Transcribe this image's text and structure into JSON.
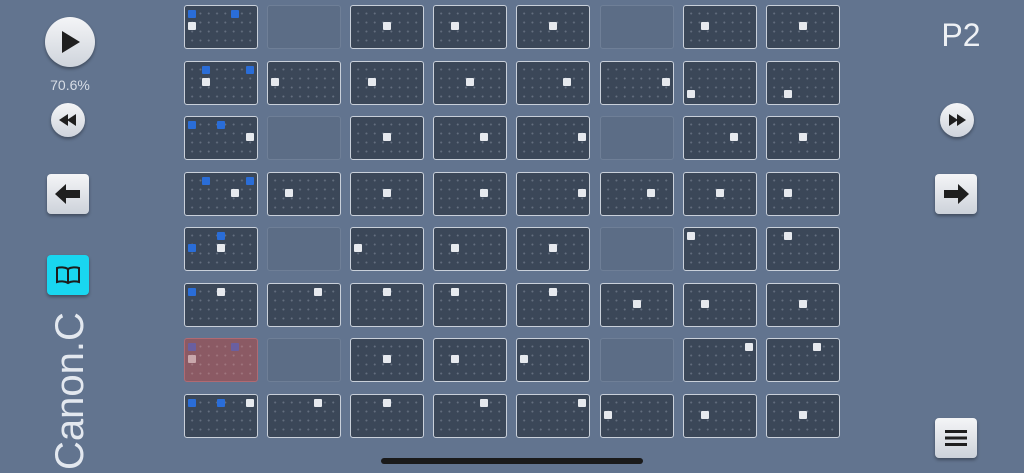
{
  "app": {
    "tempo_label": "70.6%",
    "pattern_label": "P2",
    "song_name": "Canon.C"
  },
  "colors": {
    "background": "#62748f",
    "cell_active": "#3b4758",
    "cell_empty": "#5c6d86",
    "cell_alert": "#8b5a64",
    "note_white": "#e6e9ee",
    "note_blue": "#2a6dd8",
    "book_button": "#19d6f0"
  },
  "icons": {
    "play": "play-icon",
    "rewind": "rewind-icon",
    "fast_forward": "fast-forward-icon",
    "prev": "arrow-left-icon",
    "next": "arrow-right-icon",
    "book": "book-icon",
    "menu": "menu-icon"
  },
  "grid": {
    "rows": [
      [
        "A",
        "E",
        "A",
        "A",
        "A",
        "E",
        "A",
        "A"
      ],
      [
        "A",
        "A",
        "A",
        "A",
        "A",
        "A",
        "A",
        "A"
      ],
      [
        "A",
        "E",
        "A",
        "A",
        "A",
        "E",
        "A",
        "A"
      ],
      [
        "A",
        "A",
        "A",
        "A",
        "A",
        "A",
        "A",
        "A"
      ],
      [
        "A",
        "E",
        "A",
        "A",
        "A",
        "E",
        "A",
        "A"
      ],
      [
        "A",
        "A",
        "A",
        "A",
        "A",
        "A",
        "A",
        "A"
      ],
      [
        "R",
        "E",
        "A",
        "A",
        "A",
        "E",
        "A",
        "A"
      ],
      [
        "A",
        "A",
        "A",
        "A",
        "A",
        "A",
        "A",
        "A"
      ]
    ],
    "notes": [
      [
        [
          [
            "b",
            0,
            0
          ],
          [
            "b",
            6,
            0
          ],
          [
            "w",
            0,
            2
          ]
        ],
        [],
        [
          [
            "w",
            4,
            2
          ]
        ],
        [
          [
            "w",
            2,
            2
          ]
        ],
        [
          [
            "w",
            4,
            2
          ]
        ],
        [],
        [
          [
            "w",
            2,
            2
          ]
        ],
        [
          [
            "w",
            4,
            2
          ]
        ]
      ],
      [
        [
          [
            "b",
            2,
            0
          ],
          [
            "b",
            8,
            0
          ],
          [
            "w",
            2,
            2
          ]
        ],
        [
          [
            "w",
            0,
            2
          ]
        ],
        [
          [
            "w",
            2,
            2
          ]
        ],
        [
          [
            "w",
            4,
            2
          ]
        ],
        [
          [
            "w",
            6,
            2
          ]
        ],
        [
          [
            "w",
            8,
            2
          ]
        ],
        [
          [
            "w",
            0,
            4
          ]
        ],
        [
          [
            "w",
            2,
            4
          ]
        ]
      ],
      [
        [
          [
            "b",
            0,
            0
          ],
          [
            "b",
            4,
            0
          ],
          [
            "w",
            8,
            2
          ]
        ],
        [],
        [
          [
            "w",
            4,
            2
          ]
        ],
        [
          [
            "w",
            6,
            2
          ]
        ],
        [
          [
            "w",
            8,
            2
          ]
        ],
        [],
        [
          [
            "w",
            6,
            2
          ]
        ],
        [
          [
            "w",
            4,
            2
          ]
        ]
      ],
      [
        [
          [
            "b",
            2,
            0
          ],
          [
            "b",
            8,
            0
          ],
          [
            "w",
            6,
            2
          ]
        ],
        [
          [
            "w",
            2,
            2
          ]
        ],
        [
          [
            "w",
            4,
            2
          ]
        ],
        [
          [
            "w",
            6,
            2
          ]
        ],
        [
          [
            "w",
            8,
            2
          ]
        ],
        [
          [
            "w",
            6,
            2
          ]
        ],
        [
          [
            "w",
            4,
            2
          ]
        ],
        [
          [
            "w",
            2,
            2
          ]
        ]
      ],
      [
        [
          [
            "b",
            4,
            0
          ],
          [
            "b",
            0,
            2
          ],
          [
            "w",
            4,
            2
          ]
        ],
        [],
        [
          [
            "w",
            0,
            2
          ]
        ],
        [
          [
            "w",
            2,
            2
          ]
        ],
        [
          [
            "w",
            4,
            2
          ]
        ],
        [],
        [
          [
            "w",
            0,
            0
          ]
        ],
        [
          [
            "w",
            2,
            0
          ]
        ]
      ],
      [
        [
          [
            "b",
            0,
            0
          ],
          [
            "w",
            4,
            0
          ]
        ],
        [
          [
            "w",
            6,
            0
          ]
        ],
        [
          [
            "w",
            4,
            0
          ]
        ],
        [
          [
            "w",
            2,
            0
          ]
        ],
        [
          [
            "w",
            4,
            0
          ]
        ],
        [
          [
            "w",
            4,
            2
          ]
        ],
        [
          [
            "w",
            2,
            2
          ]
        ],
        [
          [
            "w",
            4,
            2
          ]
        ]
      ],
      [
        [
          [
            "b",
            0,
            0
          ],
          [
            "b",
            6,
            0
          ],
          [
            "w",
            0,
            2
          ]
        ],
        [],
        [
          [
            "w",
            4,
            2
          ]
        ],
        [
          [
            "w",
            2,
            2
          ]
        ],
        [
          [
            "w",
            0,
            2
          ]
        ],
        [],
        [
          [
            "w",
            8,
            0
          ]
        ],
        [
          [
            "w",
            6,
            0
          ]
        ]
      ],
      [
        [
          [
            "b",
            0,
            0
          ],
          [
            "b",
            4,
            0
          ],
          [
            "w",
            8,
            0
          ]
        ],
        [
          [
            "w",
            6,
            0
          ]
        ],
        [
          [
            "w",
            4,
            0
          ]
        ],
        [
          [
            "w",
            6,
            0
          ]
        ],
        [
          [
            "w",
            8,
            0
          ]
        ],
        [
          [
            "w",
            0,
            2
          ]
        ],
        [
          [
            "w",
            2,
            2
          ]
        ],
        [
          [
            "w",
            4,
            2
          ]
        ]
      ]
    ]
  }
}
